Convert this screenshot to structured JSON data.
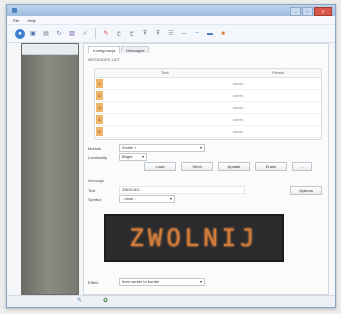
{
  "window": {
    "title": ""
  },
  "menu": [
    "File",
    "Help"
  ],
  "toolbar": {
    "icons": [
      "open-icon",
      "save-icon",
      "print-icon",
      "refresh-icon",
      "image-icon",
      "check-icon",
      "paint-icon",
      "text-icon",
      "text2-icon",
      "text3-icon",
      "text4-icon",
      "chart-icon",
      "line-icon",
      "cut-icon",
      "copy-icon"
    ]
  },
  "tabs": [
    {
      "label": "Konfiguracja"
    },
    {
      "label": "Messages"
    }
  ],
  "list": {
    "title": "MESSAGES LIST",
    "headers": [
      "Text",
      "Preset"
    ],
    "rows": [
      {
        "num": "1",
        "text": "",
        "name": "name -"
      },
      {
        "num": "2",
        "text": "",
        "name": "name -"
      },
      {
        "num": "3",
        "text": "",
        "name": "name -"
      },
      {
        "num": "4",
        "text": "",
        "name": "name -"
      },
      {
        "num": "5",
        "text": "",
        "name": "name"
      }
    ]
  },
  "fields": {
    "module_label": "Module",
    "module_value": "Zvolte +",
    "luminosity_label": "Luminosity",
    "luminosity_value": "Bright"
  },
  "buttons": {
    "load": "Load",
    "send": "Send",
    "update": "Update",
    "erase": "Erase",
    "extra": "...",
    "options": "Options"
  },
  "message": {
    "section": "Message",
    "text_label": "Text",
    "text_value": "ZWOLNIJ",
    "symbol_label": "Symbol",
    "symbol_value": "- none -",
    "display_text": "ZWOLNIJ"
  },
  "effect": {
    "label": "Effect",
    "value": "from center to border"
  },
  "colors": {
    "accent": "#4d82c4",
    "led_text": "#d07a39",
    "led_bg": "#2b2b2d",
    "close": "#d9564a"
  }
}
